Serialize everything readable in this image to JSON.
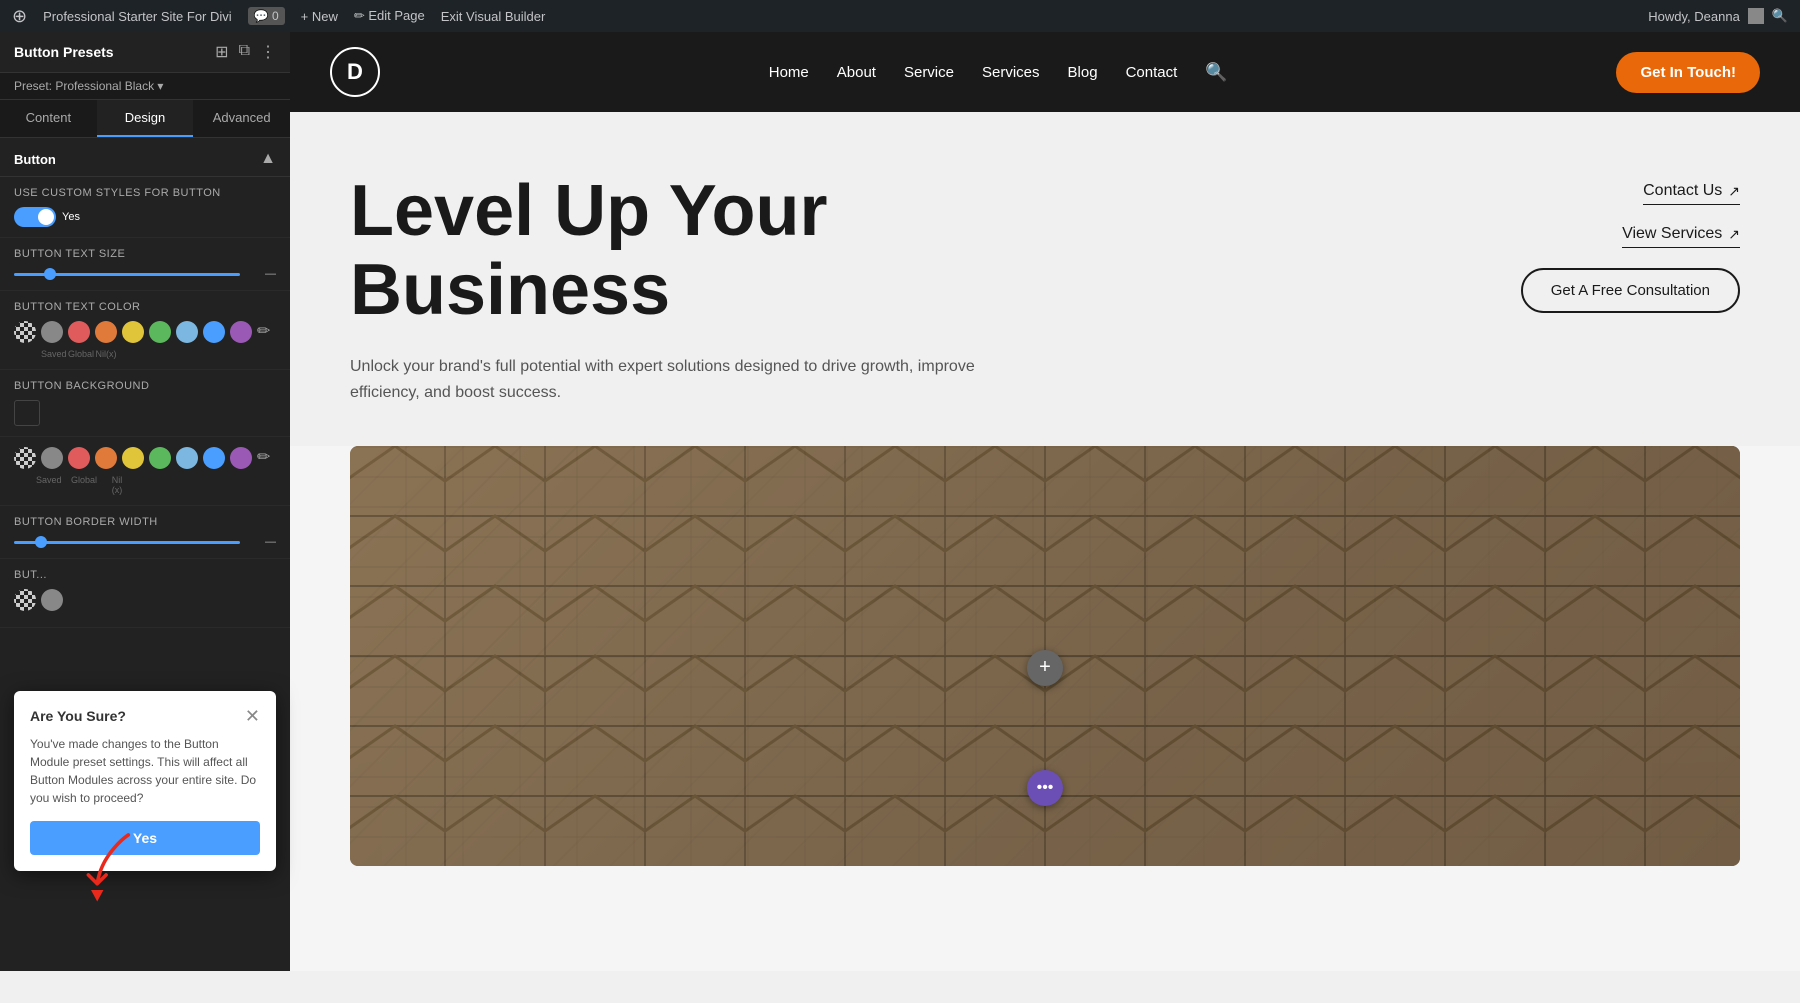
{
  "admin_bar": {
    "wp_icon": "⊕",
    "site_name": "Professional Starter Site For Divi",
    "comment_count": "0",
    "new_label": "+ New",
    "edit_page_label": "✏ Edit Page",
    "exit_builder_label": "Exit Visual Builder",
    "howdy_label": "Howdy, Deanna"
  },
  "left_panel": {
    "title": "Button Presets",
    "preset_label": "Preset: Professional Black ▾",
    "tabs": [
      {
        "id": "content",
        "label": "Content"
      },
      {
        "id": "design",
        "label": "Design",
        "active": true
      },
      {
        "id": "advanced",
        "label": "Advanced"
      }
    ],
    "section_title": "Button",
    "fields": {
      "custom_styles_label": "Use Custom Styles For Button",
      "toggle_state": "Yes",
      "text_size_label": "Button Text Size",
      "text_size_value": "",
      "text_color_label": "Button Text Color",
      "color_swatches": [
        {
          "id": "transparent",
          "type": "transparent",
          "label": "..."
        },
        {
          "id": "gray",
          "type": "gray",
          "label": "Saved"
        },
        {
          "id": "red",
          "type": "red",
          "label": "Global"
        },
        {
          "id": "orange",
          "type": "orange",
          "label": "Nil (x)"
        },
        {
          "id": "yellow",
          "type": "yellow",
          "label": ""
        },
        {
          "id": "green",
          "type": "green",
          "label": ""
        },
        {
          "id": "blue-light",
          "type": "blue-light",
          "label": ""
        },
        {
          "id": "blue",
          "type": "blue",
          "label": ""
        },
        {
          "id": "purple",
          "type": "purple",
          "label": ""
        }
      ],
      "bg_label": "Button Background",
      "border_width_label": "Button Border Width"
    },
    "confirm_dialog": {
      "title": "Are You Sure?",
      "body": "You've made changes to the Button Module preset settings. This will affect all Button Modules across your entire site. Do you wish to proceed?",
      "yes_label": "Yes"
    }
  },
  "site_header": {
    "logo_letter": "D",
    "nav_items": [
      {
        "label": "Home"
      },
      {
        "label": "About"
      },
      {
        "label": "Service"
      },
      {
        "label": "Services"
      },
      {
        "label": "Blog"
      },
      {
        "label": "Contact"
      }
    ],
    "cta_button": "Get In Touch!"
  },
  "hero": {
    "title_line1": "Level Up Your",
    "title_line2": "Business",
    "subtitle": "Unlock your brand's full potential with expert solutions designed to drive growth, improve efficiency, and boost success.",
    "contact_link": "Contact Us",
    "services_link": "View Services",
    "consultation_btn": "Get A Free Consultation",
    "arrow_icon": "↗"
  },
  "building_section": {
    "fab_plus": "+",
    "fab_menu": "•••"
  }
}
